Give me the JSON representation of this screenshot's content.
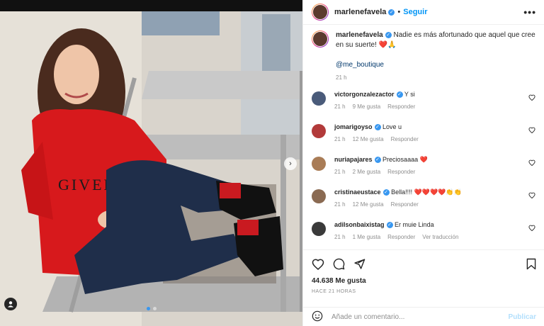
{
  "post": {
    "username": "marlenefavela",
    "follow_label": "Seguir",
    "more_label": "•••",
    "caption_text": "Nadie es más afortunado que aquel que cree en su suerte! ❤️🙏",
    "mention": "@me_boutique",
    "caption_time": "21 h"
  },
  "comments": [
    {
      "user": "victorgonzalezactor",
      "text": "Y si",
      "time": "21 h",
      "likes": "9 Me gusta",
      "reply": "Responder",
      "translate": "",
      "avatar_color": "#4a5b7a"
    },
    {
      "user": "jomarigoyso",
      "text": "Love u",
      "time": "21 h",
      "likes": "12 Me gusta",
      "reply": "Responder",
      "translate": "",
      "avatar_color": "#b23a3a"
    },
    {
      "user": "nuriapajares",
      "text": "Preciosaaaa ❤️",
      "time": "21 h",
      "likes": "2 Me gusta",
      "reply": "Responder",
      "translate": "",
      "avatar_color": "#a97c56"
    },
    {
      "user": "cristinaeustace",
      "text": "Bella!!!! ❤️❤️❤️❤️👏👏",
      "time": "21 h",
      "likes": "12 Me gusta",
      "reply": "Responder",
      "translate": "",
      "avatar_color": "#8a6a52"
    },
    {
      "user": "adilsonbaixistag",
      "text": "Er muie Linda",
      "time": "21 h",
      "likes": "1 Me gusta",
      "reply": "Responder",
      "translate": "Ver traducción",
      "avatar_color": "#3a3a3a"
    }
  ],
  "stats": {
    "likes": "44.638 Me gusta",
    "time_ago": "HACE 21 HORAS"
  },
  "add_comment": {
    "placeholder": "Añade un comentario...",
    "publish_label": "Publicar"
  },
  "colors": {
    "accent": "#0095f6",
    "verified": "#3897f0",
    "hoodie": "#d7191c"
  }
}
